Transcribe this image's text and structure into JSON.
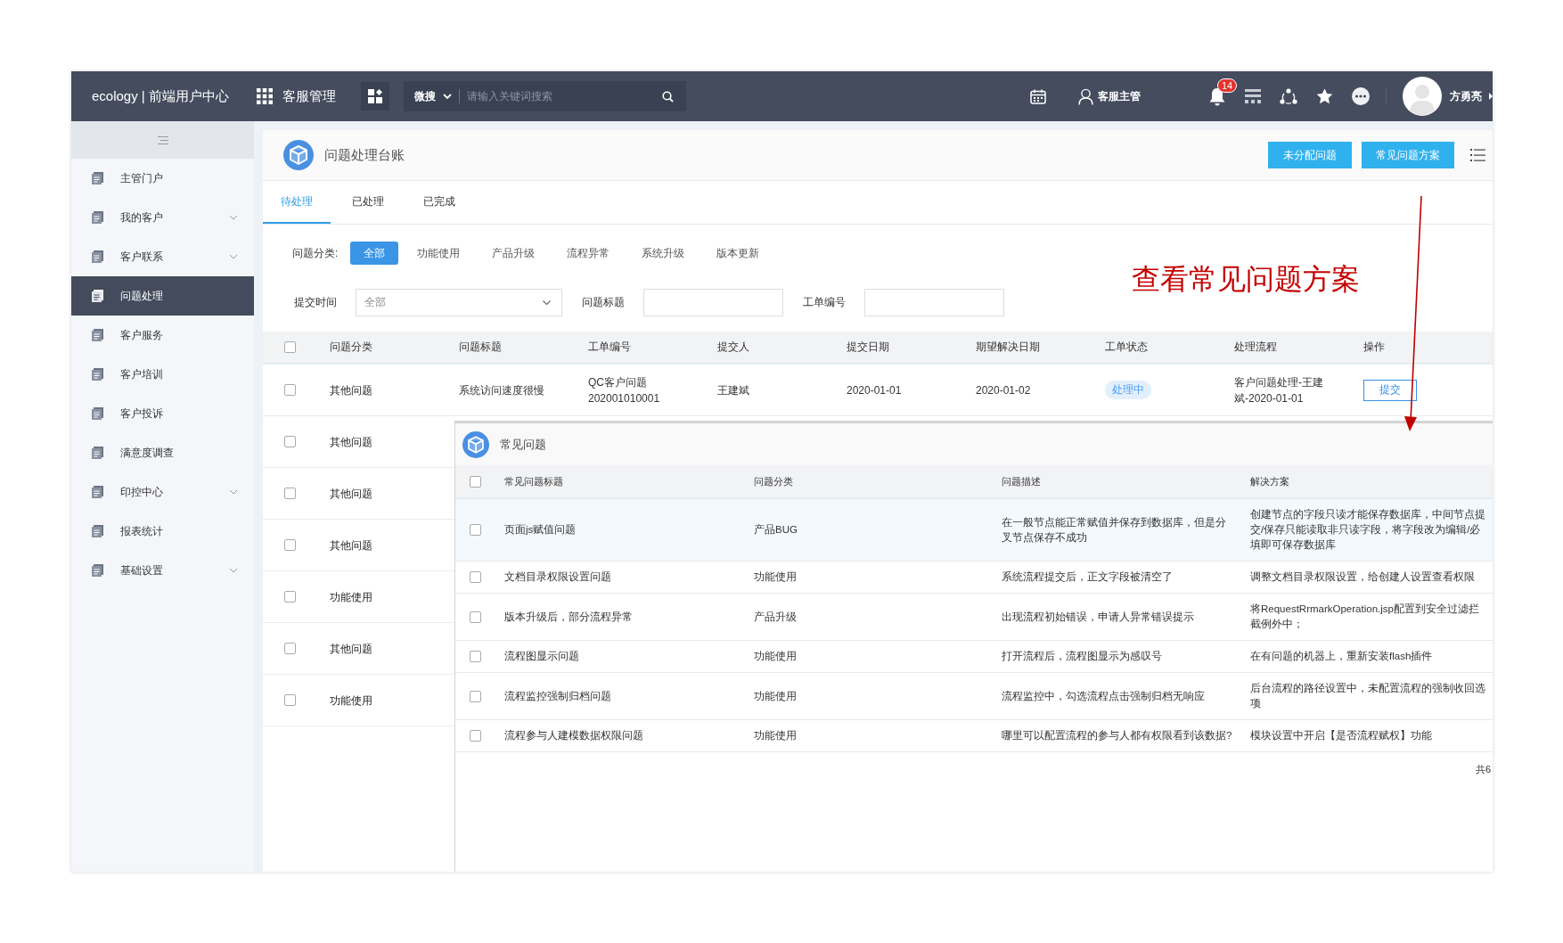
{
  "top_bar": {
    "logo": "ecology | 前端用户中心",
    "module": "客服管理",
    "search": {
      "scope": "微搜",
      "placeholder": "请输入关键词搜索"
    },
    "role": "客服主管",
    "notification_count": "14",
    "user_name": "方勇亮"
  },
  "sidebar": {
    "items": [
      {
        "label": "主管门户",
        "selected": false,
        "expandable": false
      },
      {
        "label": "我的客户",
        "selected": false,
        "expandable": true
      },
      {
        "label": "客户联系",
        "selected": false,
        "expandable": true
      },
      {
        "label": "问题处理",
        "selected": true,
        "expandable": false
      },
      {
        "label": "客户服务",
        "selected": false,
        "expandable": false
      },
      {
        "label": "客户培训",
        "selected": false,
        "expandable": false
      },
      {
        "label": "客户投诉",
        "selected": false,
        "expandable": false
      },
      {
        "label": "满意度调查",
        "selected": false,
        "expandable": false
      },
      {
        "label": "印控中心",
        "selected": false,
        "expandable": true
      },
      {
        "label": "报表统计",
        "selected": false,
        "expandable": false
      },
      {
        "label": "基础设置",
        "selected": false,
        "expandable": true
      }
    ]
  },
  "page": {
    "title": "问题处理台账",
    "buttons": [
      "未分配问题",
      "常见问题方案"
    ]
  },
  "tabs": [
    {
      "label": "待处理",
      "selected": true
    },
    {
      "label": "已处理",
      "selected": false
    },
    {
      "label": "已完成",
      "selected": false
    }
  ],
  "filters": {
    "category_label": "问题分类:",
    "categories": [
      {
        "label": "全部",
        "selected": true
      },
      {
        "label": "功能使用",
        "selected": false
      },
      {
        "label": "产品升级",
        "selected": false
      },
      {
        "label": "流程异常",
        "selected": false
      },
      {
        "label": "系统升级",
        "selected": false
      },
      {
        "label": "版本更新",
        "selected": false
      }
    ],
    "fields": [
      {
        "label": "提交时间",
        "kind": "select",
        "value": "全部"
      },
      {
        "label": "问题标题",
        "kind": "text"
      },
      {
        "label": "工单编号",
        "kind": "text"
      }
    ]
  },
  "table": {
    "all_checked": false,
    "columns": [
      "问题分类",
      "问题标题",
      "工单编号",
      "提交人",
      "提交日期",
      "期望解决日期",
      "工单状态",
      "处理流程",
      "操作"
    ],
    "rows": [
      {
        "checked": false,
        "category": "其他问题",
        "title": "系统访问速度很慢",
        "ticket_no": "QC客户问题202001010001",
        "submitter": "王建斌",
        "submit_date": "2020-01-01",
        "expected_date": "2020-01-02",
        "status": "处理中",
        "workflow": "客户问题处理-王建斌-2020-01-01",
        "action": "提交"
      },
      {
        "checked": false,
        "category": "其他问题"
      },
      {
        "checked": false,
        "category": "其他问题"
      },
      {
        "checked": false,
        "category": "其他问题"
      },
      {
        "checked": false,
        "category": "功能使用"
      },
      {
        "checked": false,
        "category": "其他问题"
      },
      {
        "checked": false,
        "category": "功能使用"
      }
    ]
  },
  "popup": {
    "title": "常见问题",
    "all_checked": false,
    "columns": [
      "常见问题标题",
      "问题分类",
      "问题描述",
      "解决方案"
    ],
    "rows": [
      {
        "checked": false,
        "highlighted": true,
        "title": "页面js赋值问题",
        "category": "产品BUG",
        "description": "在一般节点能正常赋值并保存到数据库，但是分叉节点保存不成功",
        "solution": "创建节点的字段只读才能保存数据库，中间节点提交/保存只能读取非只读字段，将字段改为编辑/必填即可保存数据库"
      },
      {
        "checked": false,
        "highlighted": false,
        "title": "文档目录权限设置问题",
        "category": "功能使用",
        "description": "系统流程提交后，正文字段被清空了",
        "solution": "调整文档目录权限设置，给创建人设置查看权限"
      },
      {
        "checked": false,
        "highlighted": false,
        "title": "版本升级后，部分流程异常",
        "category": "产品升级",
        "description": "出现流程初始错误，申请人异常错误提示",
        "solution": "将RequestRrmarkOperation.jsp配置到安全过滤拦截例外中；"
      },
      {
        "checked": false,
        "highlighted": false,
        "title": "流程图显示问题",
        "category": "功能使用",
        "description": "打开流程后，流程图显示为感叹号",
        "solution": "在有问题的机器上，重新安装flash插件"
      },
      {
        "checked": false,
        "highlighted": false,
        "title": "流程监控强制归档问题",
        "category": "功能使用",
        "description": "流程监控中，勾选流程点击强制归档无响应",
        "solution": "后台流程的路径设置中，未配置流程的强制收回选项"
      },
      {
        "checked": false,
        "highlighted": false,
        "title": "流程参与人建模数据权限问题",
        "category": "功能使用",
        "description": "哪里可以配置流程的参与人都有权限看到该数据?",
        "solution": "模块设置中开启【是否流程赋权】功能"
      }
    ],
    "footer": "共6"
  },
  "annotation": {
    "text": "查看常见问题方案"
  }
}
